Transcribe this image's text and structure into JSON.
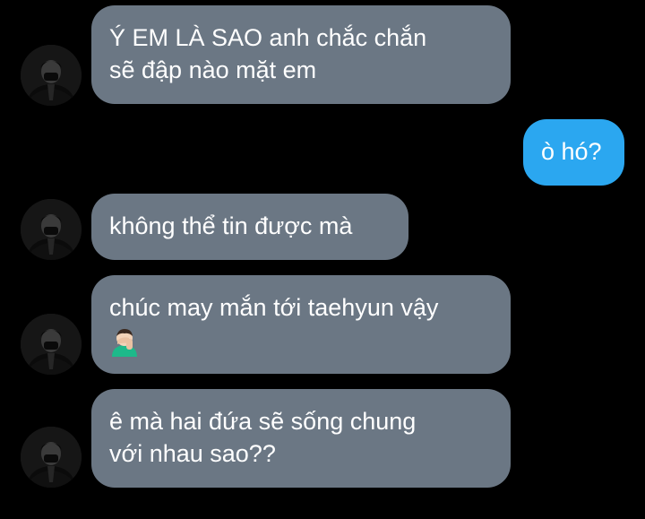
{
  "colors": {
    "background": "#000000",
    "incoming_bubble": "#6b7784",
    "outgoing_bubble": "#2ba7f0",
    "text": "#ffffff"
  },
  "messages": [
    {
      "sender": "them",
      "lines": [
        "Ý EM LÀ SAO anh chắc chắn",
        "sẽ đập nào mặt em"
      ]
    },
    {
      "sender": "me",
      "lines": [
        "ò hó?"
      ]
    },
    {
      "sender": "them",
      "lines": [
        "không thể tin được mà"
      ]
    },
    {
      "sender": "them",
      "lines": [
        "chúc may mắn tới taehyun vậy"
      ],
      "emoji": "man-facepalming-emoji"
    },
    {
      "sender": "them",
      "lines": [
        "ê mà hai đứa sẽ sống chung",
        "với nhau sao??"
      ]
    }
  ]
}
